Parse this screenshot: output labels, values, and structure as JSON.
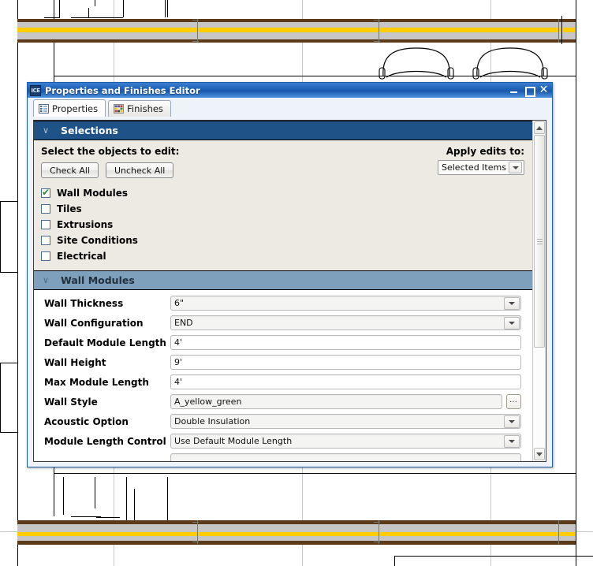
{
  "window": {
    "title": "Properties and Finishes Editor",
    "app_icon": "ICE",
    "minimize": "minimize-icon",
    "maximize": "maximize-icon",
    "close": "✕"
  },
  "tabs": [
    {
      "label": "Properties",
      "icon": "list-icon",
      "active": true
    },
    {
      "label": "Finishes",
      "icon": "color-grid-icon",
      "active": false
    }
  ],
  "selections": {
    "header": "Selections",
    "chevron": "∨",
    "prompt": "Select the objects to edit:",
    "check_all": "Check All",
    "uncheck_all": "Uncheck All",
    "apply_label": "Apply edits to:",
    "apply_value": "Selected Items",
    "items": [
      {
        "label": "Wall Modules",
        "checked": true
      },
      {
        "label": "Tiles",
        "checked": false
      },
      {
        "label": "Extrusions",
        "checked": false
      },
      {
        "label": "Site Conditions",
        "checked": false
      },
      {
        "label": "Electrical",
        "checked": false
      }
    ]
  },
  "wall_modules": {
    "header": "Wall Modules",
    "chevron": "∨",
    "fields": [
      {
        "label": "Wall Thickness",
        "value": "6\"",
        "type": "dropdown"
      },
      {
        "label": "Wall Configuration",
        "value": "END",
        "type": "dropdown"
      },
      {
        "label": "Default Module Length",
        "value": "4'",
        "type": "text"
      },
      {
        "label": "Wall Height",
        "value": "9'",
        "type": "text"
      },
      {
        "label": "Max Module Length",
        "value": "4'",
        "type": "text"
      },
      {
        "label": "Wall Style",
        "value": "A_yellow_green",
        "type": "browse"
      },
      {
        "label": "Acoustic Option",
        "value": "Double Insulation",
        "type": "dropdown"
      },
      {
        "label": "Module Length Control",
        "value": "Use Default Module Length",
        "type": "dropdown"
      }
    ]
  },
  "colors": {
    "titlebar_blue": "#1b5fb5",
    "section_dark": "#1f5387",
    "section_light": "#7ea0bc",
    "panel_beige": "#edeae3",
    "check_green": "#1f8a2a",
    "cad_wall_brown": "#5a3a18",
    "cad_wall_yellow": "#ffcc00",
    "cad_wall_gray": "#c6c6c6"
  }
}
